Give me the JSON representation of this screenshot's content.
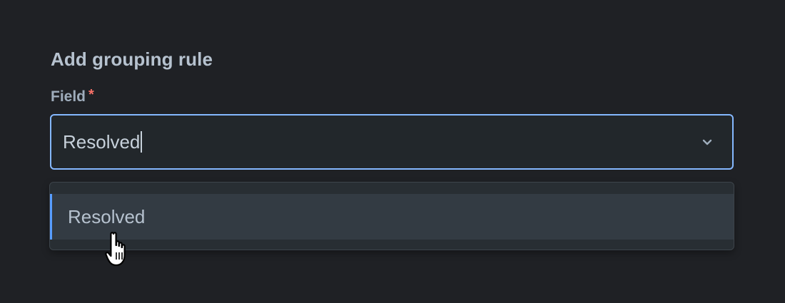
{
  "form": {
    "title": "Add grouping rule",
    "field_label": "Field",
    "required_marker": "*",
    "select_value": "Resolved"
  },
  "dropdown": {
    "options": [
      {
        "label": "Resolved",
        "highlighted": true
      }
    ]
  },
  "icons": {
    "select_toggle": "chevron-down-icon",
    "pointer": "hand-pointer-cursor-icon"
  },
  "colors": {
    "background": "#1f2125",
    "focus_border": "#85b8ff",
    "option_accent": "#579dff",
    "required": "#f87168"
  }
}
